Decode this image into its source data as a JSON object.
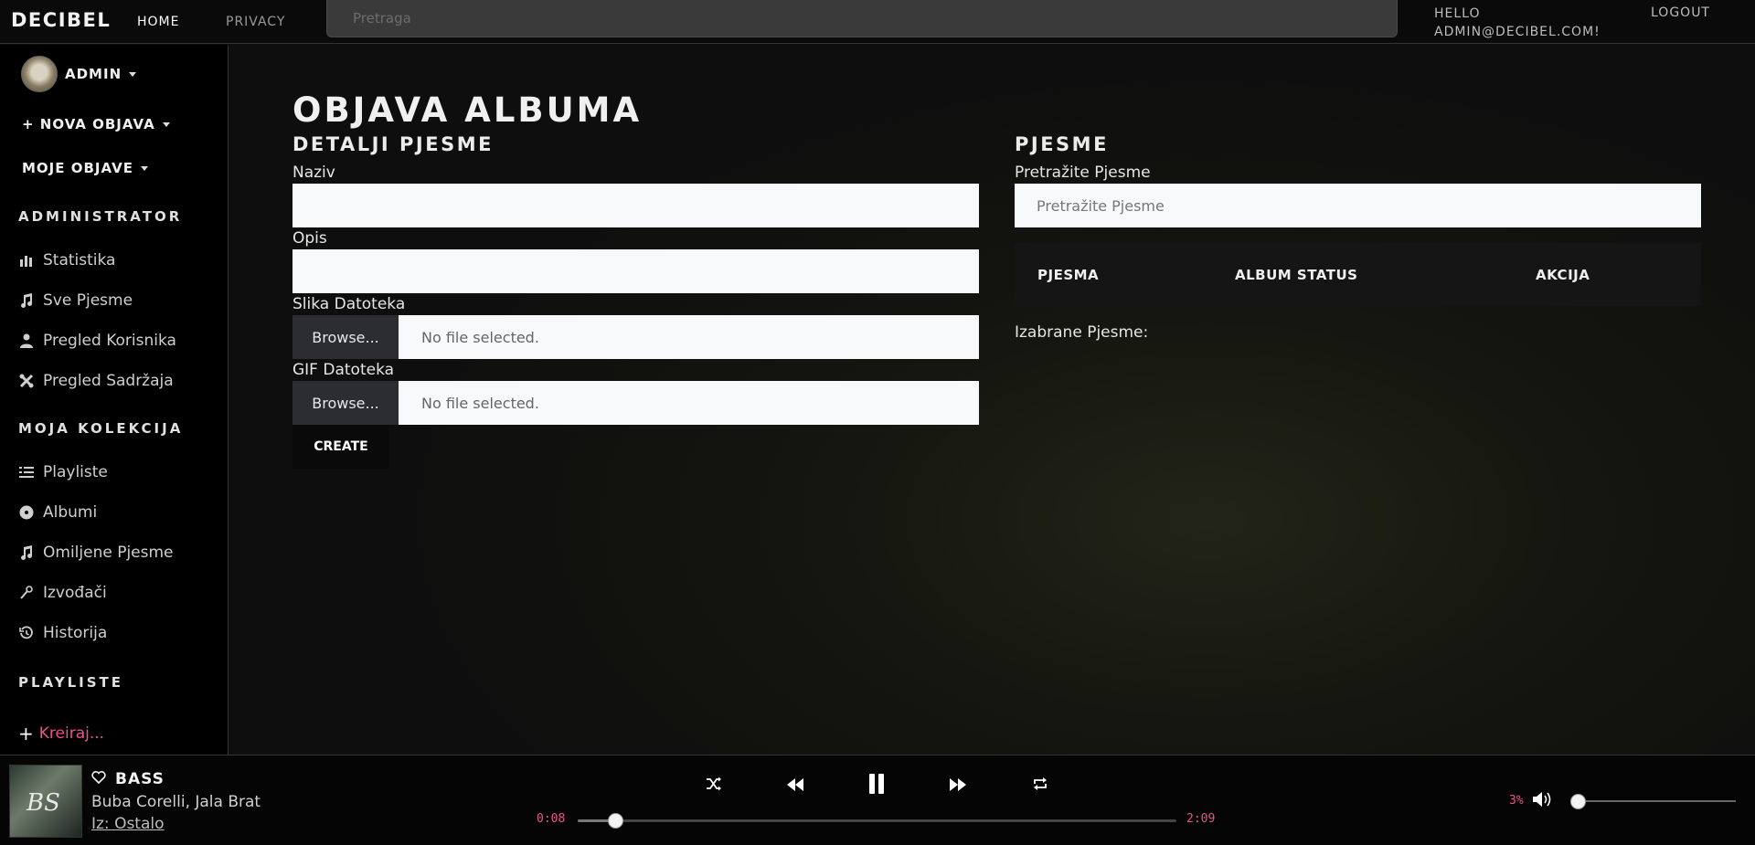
{
  "nav": {
    "brand": "DECIBEL",
    "home": "HOME",
    "privacy": "PRIVACY",
    "search_placeholder": "Pretraga",
    "hello_line1": "HELLO",
    "hello_line2": "ADMIN@DECIBEL.COM!",
    "logout": "LOGOUT"
  },
  "sidebar": {
    "profile_name": "ADMIN",
    "nova_objava": "NOVA OBJAVA",
    "moje_objave": "MOJE OBJAVE",
    "sections": {
      "administrator": "ADMINISTRATOR",
      "kolekcija": "MOJA KOLEKCIJA",
      "playliste": "PLAYLISTE"
    },
    "admin_items": [
      {
        "label": "Statistika",
        "icon": "bar-chart-icon"
      },
      {
        "label": "Sve Pjesme",
        "icon": "music-note-icon"
      },
      {
        "label": "Pregled Korisnika",
        "icon": "user-icon"
      },
      {
        "label": "Pregled Sadržaja",
        "icon": "tools-icon"
      }
    ],
    "collection_items": [
      {
        "label": "Playliste",
        "icon": "list-icon"
      },
      {
        "label": "Albumi",
        "icon": "disc-icon"
      },
      {
        "label": "Omiljene Pjesme",
        "icon": "music-note-icon"
      },
      {
        "label": "Izvođači",
        "icon": "microphone-icon"
      },
      {
        "label": "Historija",
        "icon": "history-icon"
      }
    ],
    "kreiraj": "Kreiraj..."
  },
  "main": {
    "page_title": "OBJAVA ALBUMA",
    "details_title": "DETALJI PJESME",
    "naziv_label": "Naziv",
    "opis_label": "Opis",
    "slika_label": "Slika Datoteka",
    "gif_label": "GIF Datoteka",
    "browse": "Browse...",
    "no_file": "No file selected.",
    "create": "CREATE",
    "songs_title": "PJESME",
    "songs_search_label": "Pretražite Pjesme",
    "songs_search_placeholder": "Pretražite Pjesme",
    "table_headers": [
      "PJESMA",
      "ALBUM STATUS",
      "AKCIJA"
    ],
    "selected_label": "Izabrane Pjesme:"
  },
  "player": {
    "title": "BASS",
    "artist": "Buba Corelli, Jala Brat",
    "source": "Iz: Ostalo",
    "time_current": "0:08",
    "time_total": "2:09",
    "progress": 0.062,
    "volume_text": "3%",
    "volume": 0.03
  },
  "colors": {
    "accent_pink": "#e9548e",
    "background": "#0f0f0f",
    "input_bg": "#f8f9fa"
  }
}
